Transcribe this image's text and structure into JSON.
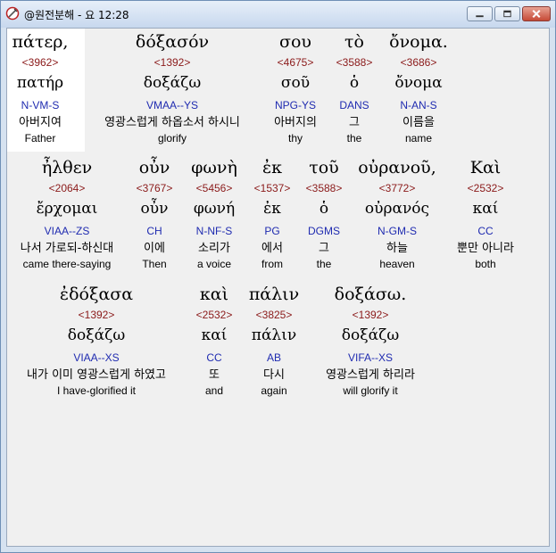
{
  "window": {
    "title": "@원전분해 - 요 12:28"
  },
  "rows": [
    [
      {
        "greek": "πάτερ,",
        "strong": "<3962>",
        "lemma": "πατήρ",
        "morph": "N-VM-S",
        "korean": "아버지여",
        "english": "Father"
      },
      {
        "greek": "δόξασόν",
        "strong": "<1392>",
        "lemma": "δοξάζω",
        "morph": "VMAA--YS",
        "korean": "영광스럽게 하옵소서 하시니",
        "english": "glorify"
      },
      {
        "greek": "σου",
        "strong": "<4675>",
        "lemma": "σοῦ",
        "morph": "NPG-YS",
        "korean": "아버지의",
        "english": "thy"
      },
      {
        "greek": "τὸ",
        "strong": "<3588>",
        "lemma": "ὁ",
        "morph": "DANS",
        "korean": "그",
        "english": "the"
      },
      {
        "greek": "ὄνομα.",
        "strong": "<3686>",
        "lemma": "ὄνομα",
        "morph": "N-AN-S",
        "korean": "이름을",
        "english": "name"
      }
    ],
    [
      {
        "greek": "ἦλθεν",
        "strong": "<2064>",
        "lemma": "ἔρχομαι",
        "morph": "VIAA--ZS",
        "korean": "나서 가로되-하신대",
        "english": "came there-saying"
      },
      {
        "greek": "οὖν",
        "strong": "<3767>",
        "lemma": "οὖν",
        "morph": "CH",
        "korean": "이에",
        "english": "Then"
      },
      {
        "greek": "φωνὴ",
        "strong": "<5456>",
        "lemma": "φωνή",
        "morph": "N-NF-S",
        "korean": "소리가",
        "english": "a voice"
      },
      {
        "greek": "ἐκ",
        "strong": "<1537>",
        "lemma": "ἐκ",
        "morph": "PG",
        "korean": "에서",
        "english": "from"
      },
      {
        "greek": "τοῦ",
        "strong": "<3588>",
        "lemma": "ὁ",
        "morph": "DGMS",
        "korean": "그",
        "english": "the"
      },
      {
        "greek": "οὐρανοῦ,",
        "strong": "<3772>",
        "lemma": "οὐρανός",
        "morph": "N-GM-S",
        "korean": "하늘",
        "english": "heaven"
      },
      {
        "greek": "Καὶ",
        "strong": "<2532>",
        "lemma": "καί",
        "morph": "CC",
        "korean": "뿐만 아니라",
        "english": "both"
      }
    ],
    [
      {
        "greek": "ἐδόξασα",
        "strong": "<1392>",
        "lemma": "δοξάζω",
        "morph": "VIAA--XS",
        "korean": "내가 이미 영광스럽게 하였고",
        "english": "I have-glorified it"
      },
      {
        "greek": "καὶ",
        "strong": "<2532>",
        "lemma": "καί",
        "morph": "CC",
        "korean": "또",
        "english": "and"
      },
      {
        "greek": "πάλιν",
        "strong": "<3825>",
        "lemma": "πάλιν",
        "morph": "AB",
        "korean": "다시",
        "english": "again"
      },
      {
        "greek": "δοξάσω.",
        "strong": "<1392>",
        "lemma": "δοξάζω",
        "morph": "VIFA--XS",
        "korean": "영광스럽게 하리라",
        "english": "will glorify it"
      }
    ]
  ]
}
